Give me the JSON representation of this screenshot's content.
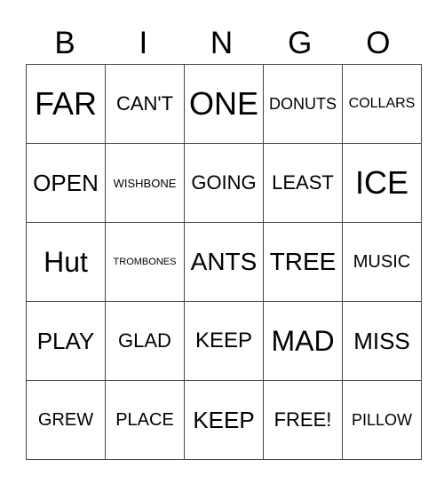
{
  "header": [
    "B",
    "I",
    "N",
    "G",
    "O"
  ],
  "rows": [
    [
      "FAR",
      "CAN'T",
      "ONE",
      "DONUTS",
      "COLLARS"
    ],
    [
      "OPEN",
      "WISHBONE",
      "GOING",
      "LEAST",
      "ICE"
    ],
    [
      "Hut",
      "TROMBONES",
      "ANTS",
      "TREE",
      "MUSIC"
    ],
    [
      "PLAY",
      "GLAD",
      "KEEP",
      "MAD",
      "MISS"
    ],
    [
      "GREW",
      "PLACE",
      "KEEP",
      "FREE!",
      "PILLOW"
    ]
  ]
}
